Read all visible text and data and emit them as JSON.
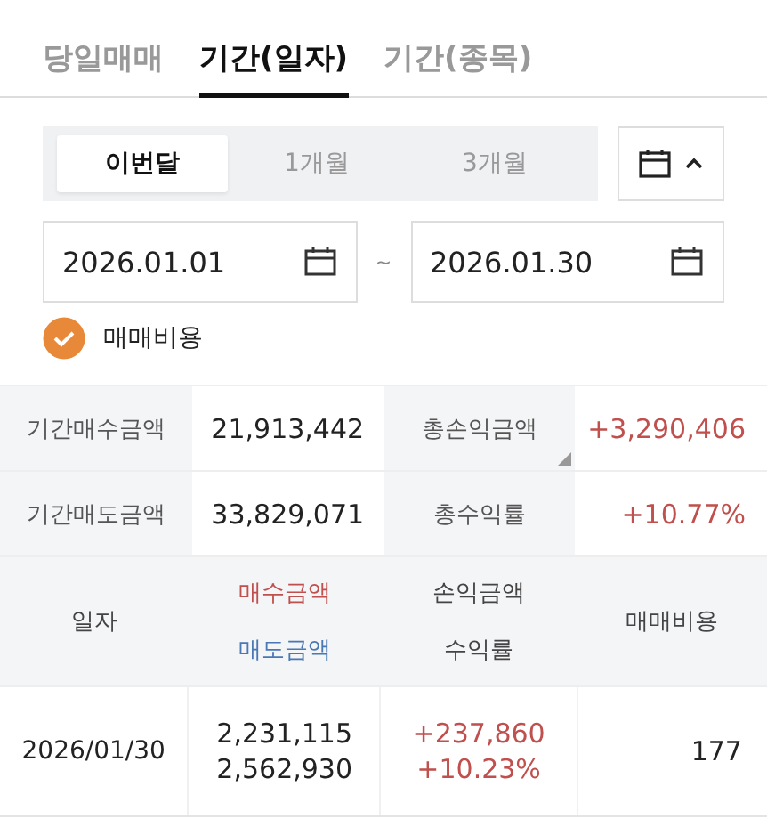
{
  "tabs": [
    {
      "label": "당일매매",
      "selected": false
    },
    {
      "label": "기간(일자)",
      "selected": true
    },
    {
      "label": "기간(종목)",
      "selected": false
    }
  ],
  "period_options": [
    {
      "label": "이번달",
      "selected": true
    },
    {
      "label": "1개월",
      "selected": false
    },
    {
      "label": "3개월",
      "selected": false
    }
  ],
  "calendar_toggle": {
    "expanded": true
  },
  "date_range": {
    "start": "2026.01.01",
    "separator": "~",
    "end": "2026.01.30"
  },
  "trade_cost_option": {
    "label": "매매비용",
    "checked": true
  },
  "summary": [
    {
      "label": "기간매수금액",
      "value": "21,913,442",
      "label_2": "총손익금액",
      "value_2": "+3,290,406",
      "has_corner_mark": true
    },
    {
      "label": "기간매도금액",
      "value": "33,829,071",
      "label_2": "총수익률",
      "value_2": "+10.77%",
      "has_corner_mark": false
    }
  ],
  "table": {
    "columns": {
      "date": "일자",
      "buy_amount": "매수금액",
      "sell_amount": "매도금액",
      "profit_amount": "손익금액",
      "profit_rate": "수익률",
      "trade_cost": "매매비용"
    },
    "rows": [
      {
        "date": "2026/01/30",
        "buy_amount": "2,231,115",
        "sell_amount": "2,562,930",
        "profit_amount": "+237,860",
        "profit_rate": "+10.23%",
        "trade_cost": "177"
      }
    ]
  }
}
